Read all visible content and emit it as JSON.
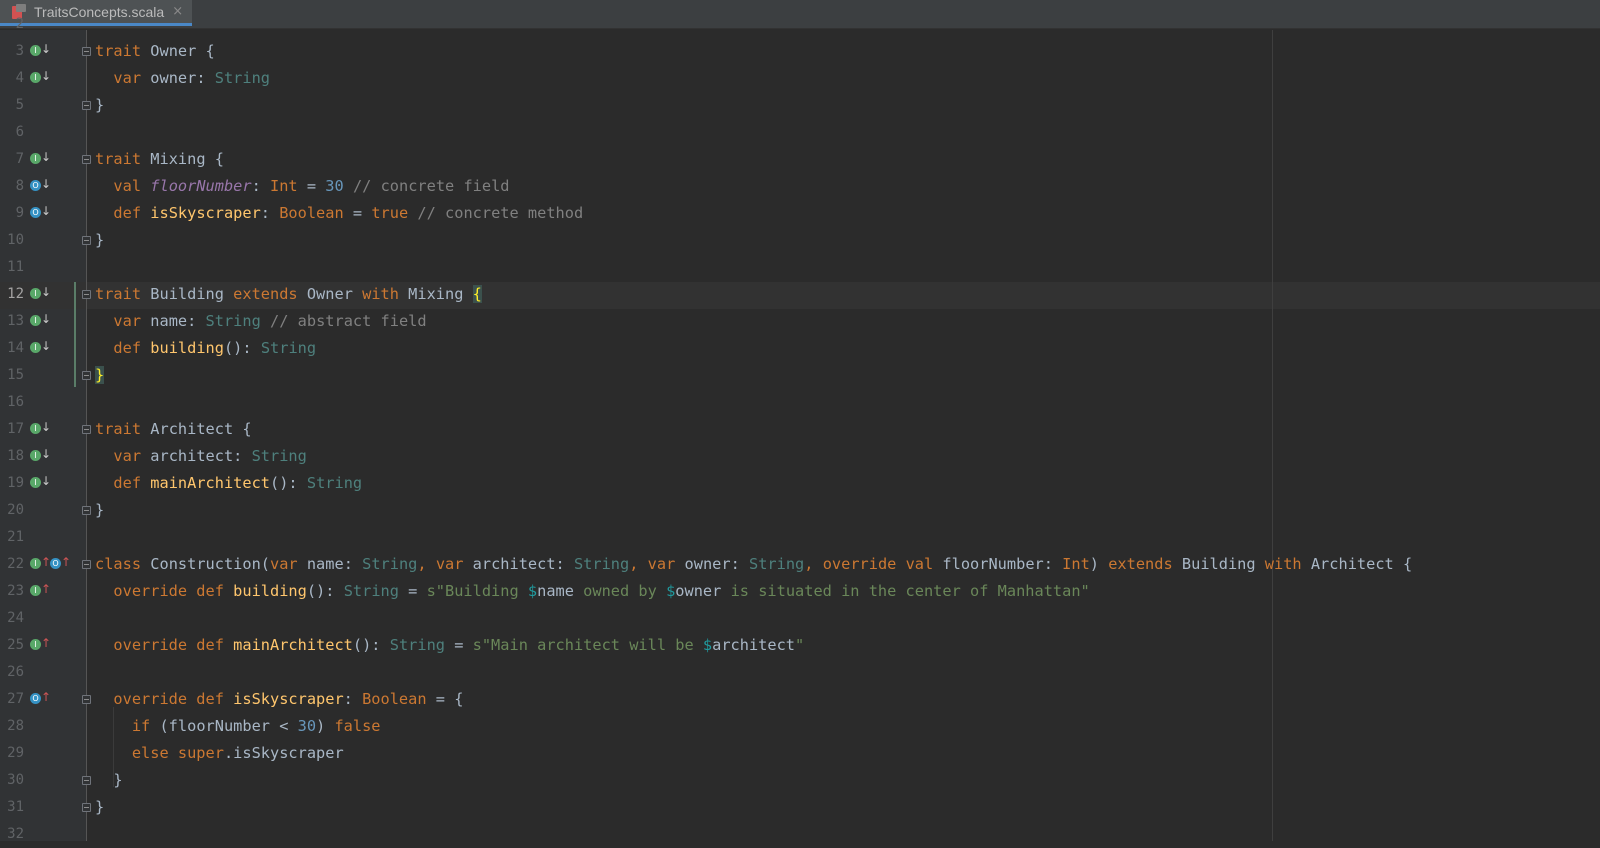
{
  "tab": {
    "filename": "TraitsConcepts.scala",
    "close_glyph": "×",
    "file_icon": "scala-file-icon"
  },
  "editor": {
    "current_line": 12,
    "top_partial_line": "2",
    "bottom_partial_line": "32",
    "lines": [
      {
        "n": "3",
        "text": "trait Owner {"
      },
      {
        "n": "4",
        "text": "  var owner: String"
      },
      {
        "n": "5",
        "text": "}"
      },
      {
        "n": "6",
        "text": ""
      },
      {
        "n": "7",
        "text": "trait Mixing {"
      },
      {
        "n": "8",
        "text": "  val floorNumber: Int = 30 // concrete field"
      },
      {
        "n": "9",
        "text": "  def isSkyscraper: Boolean = true // concrete method"
      },
      {
        "n": "10",
        "text": "}"
      },
      {
        "n": "11",
        "text": ""
      },
      {
        "n": "12",
        "text": "trait Building extends Owner with Mixing {"
      },
      {
        "n": "13",
        "text": "  var name: String // abstract field"
      },
      {
        "n": "14",
        "text": "  def building(): String"
      },
      {
        "n": "15",
        "text": "}"
      },
      {
        "n": "16",
        "text": ""
      },
      {
        "n": "17",
        "text": "trait Architect {"
      },
      {
        "n": "18",
        "text": "  var architect: String"
      },
      {
        "n": "19",
        "text": "  def mainArchitect(): String"
      },
      {
        "n": "20",
        "text": "}"
      },
      {
        "n": "21",
        "text": ""
      },
      {
        "n": "22",
        "text": "class Construction(var name: String, var architect: String, var owner: String, override val floorNumber: Int) extends Building with Architect {"
      },
      {
        "n": "23",
        "text": "  override def building(): String = s\"Building $name owned by $owner is situated in the center of Manhattan\""
      },
      {
        "n": "24",
        "text": ""
      },
      {
        "n": "25",
        "text": "  override def mainArchitect(): String = s\"Main architect will be $architect\""
      },
      {
        "n": "26",
        "text": ""
      },
      {
        "n": "27",
        "text": "  override def isSkyscraper: Boolean = {"
      },
      {
        "n": "28",
        "text": "    if (floorNumber < 30) false"
      },
      {
        "n": "29",
        "text": "    else super.isSkyscraper"
      },
      {
        "n": "30",
        "text": "  }"
      },
      {
        "n": "31",
        "text": "}"
      }
    ]
  },
  "colors": {
    "background": "#2b2b2b",
    "keyword": "#cc7832",
    "type": "#4e807d",
    "number": "#6897bb",
    "comment": "#808080",
    "string": "#6a8759",
    "field": "#9876aa",
    "function": "#ffc66d",
    "interpolation": "#20999d"
  }
}
